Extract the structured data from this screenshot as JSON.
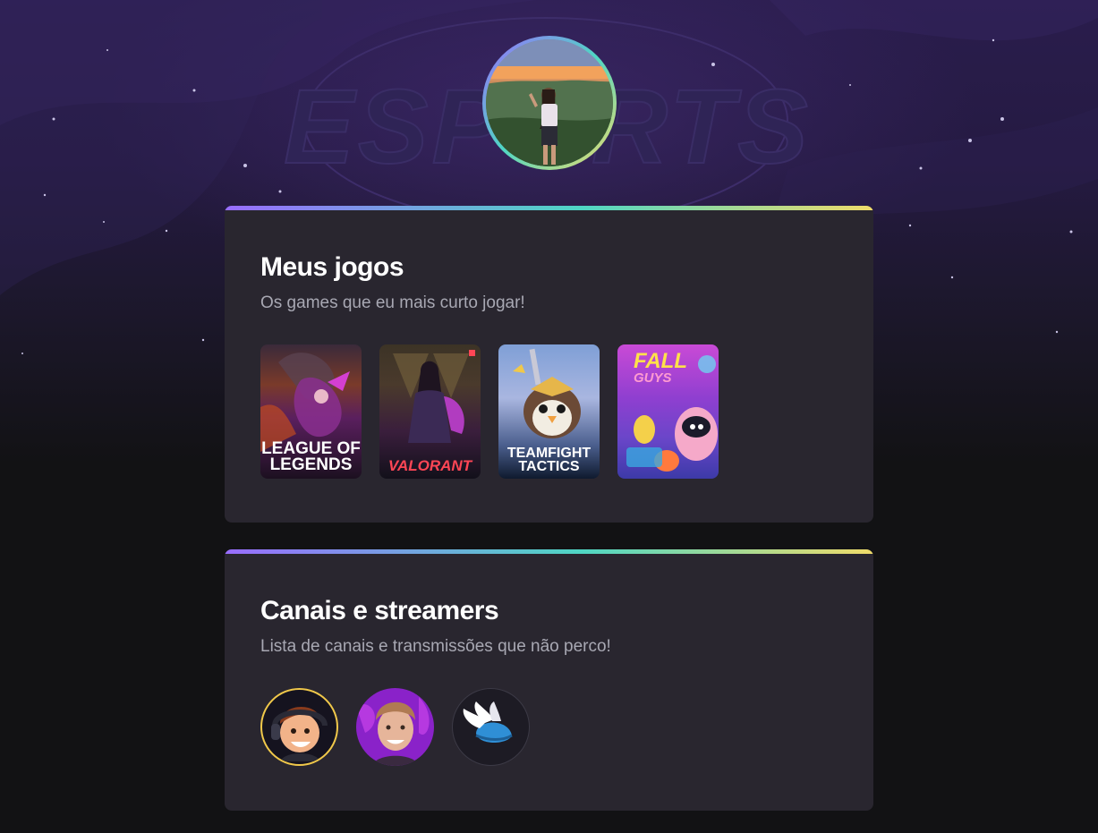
{
  "header": {
    "background_text": "ESPORTS",
    "avatar_alt": "profile photo"
  },
  "games_section": {
    "title": "Meus jogos",
    "subtitle": "Os games que eu mais curto jogar!",
    "games": [
      {
        "line1": "LEAGUE OF",
        "line2": "LEGENDS"
      },
      {
        "line1": "",
        "line2": "VALORANT"
      },
      {
        "line1": "TEAMFIGHT",
        "line2": "TACTICS"
      },
      {
        "line1": "FALL",
        "line2": "GUYS"
      }
    ]
  },
  "streams_section": {
    "title": "Canais e streamers",
    "subtitle": "Lista de canais e transmissões que não perco!"
  },
  "colors": {
    "page_bg": "#121214",
    "card_bg": "#29262f",
    "gradient": [
      "#996dff",
      "#4fd6c4",
      "#f0dc6a"
    ]
  }
}
